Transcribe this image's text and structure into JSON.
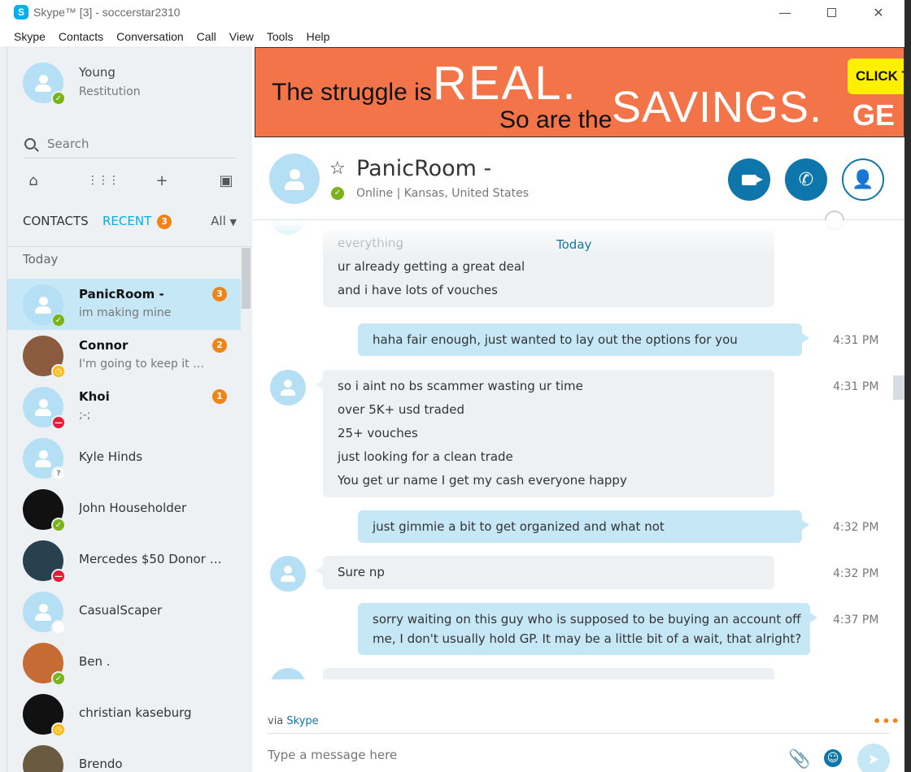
{
  "window": {
    "title": "Skype™ [3] - soccerstar2310",
    "logo": "S"
  },
  "menu": [
    "Skype",
    "Contacts",
    "Conversation",
    "Call",
    "View",
    "Tools",
    "Help"
  ],
  "profile": {
    "name": "Young",
    "mood": "Restitution",
    "status": "online"
  },
  "search": {
    "placeholder": "Search"
  },
  "tabs": {
    "contacts": "CONTACTS",
    "recent": "RECENT",
    "recent_badge": "3",
    "filter": "All"
  },
  "section": {
    "today": "Today"
  },
  "contacts": [
    {
      "name": "PanicRoom -",
      "message": "im making mine",
      "badge": "3",
      "status": "online"
    },
    {
      "name": "Connor",
      "message": "I'm going to keep it f...",
      "badge": "2",
      "status": "away"
    },
    {
      "name": "Khoi",
      "message": ";-;",
      "badge": "1",
      "status": "dnd"
    },
    {
      "name": "Kyle Hinds",
      "message": "",
      "badge": "",
      "status": "unknown"
    },
    {
      "name": "John Householder",
      "message": "",
      "badge": "",
      "status": "online"
    },
    {
      "name": "Mercedes $50 Donor -A...",
      "message": "",
      "badge": "",
      "status": "dnd"
    },
    {
      "name": "CasualScaper",
      "message": "",
      "badge": "",
      "status": "offline"
    },
    {
      "name": "Ben .",
      "message": "",
      "badge": "",
      "status": "online"
    },
    {
      "name": "christian kaseburg",
      "message": "",
      "badge": "",
      "status": "away"
    },
    {
      "name": "Brendo",
      "message": "",
      "badge": "",
      "status": ""
    }
  ],
  "ad": {
    "line1": "The struggle is",
    "real": "REAL.",
    "line2": "So are the",
    "savings": "SAVINGS.",
    "ge": "GE",
    "cta": "CLICK T"
  },
  "conversation": {
    "name": "PanicRoom -",
    "status": "Online",
    "location": "Kansas, United States",
    "status_line": "Online  |  Kansas, United States",
    "day_label": "Today"
  },
  "messages": [
    {
      "dir": "in",
      "lines": [
        "everything",
        "ur already getting a great deal",
        "and i have lots of vouches"
      ],
      "time": ""
    },
    {
      "dir": "out",
      "lines": [
        "haha fair enough, just wanted to lay out the options for you"
      ],
      "time": "4:31 PM"
    },
    {
      "dir": "in",
      "lines": [
        "so i aint no bs scammer wasting ur time",
        "over 5K+ usd traded",
        "25+ vouches",
        "just looking for a clean trade",
        "You get ur name I get my cash everyone happy"
      ],
      "time": "4:31 PM"
    },
    {
      "dir": "out",
      "lines": [
        "just gimmie a bit to get organized and what not"
      ],
      "time": "4:32 PM"
    },
    {
      "dir": "in",
      "lines": [
        "Sure np"
      ],
      "time": "4:32 PM"
    },
    {
      "dir": "out",
      "lines": [
        "sorry waiting on this guy who is supposed to be buying an account off",
        "me, I don't usually hold GP. It may be a little bit of a wait, that alright?"
      ],
      "time": "4:37 PM"
    }
  ],
  "footer": {
    "via": "via",
    "via_link": "Skype",
    "composer_placeholder": "Type a message here"
  },
  "colors": {
    "accent": "#00aff0",
    "call_blue": "#0e76ab",
    "badge_orange": "#f08416",
    "online": "#7bb31a",
    "away": "#fdb813",
    "dnd": "#e41c38",
    "ad_bg": "#f4744a"
  }
}
